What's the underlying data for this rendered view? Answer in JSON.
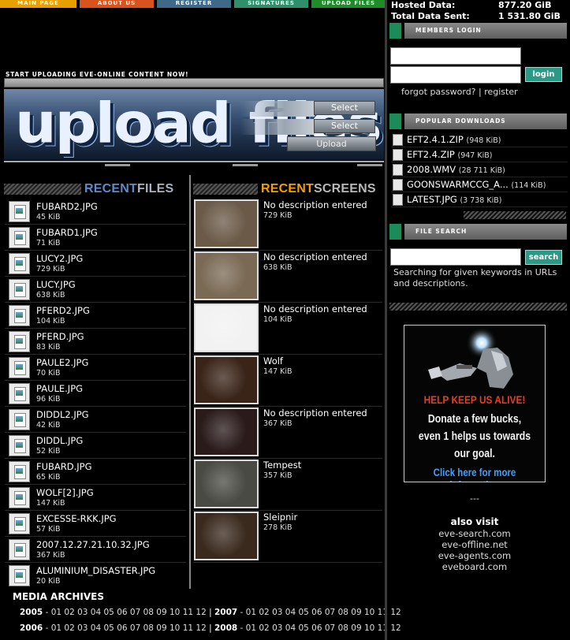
{
  "nav": {
    "tabs": [
      "MAIN PAGE",
      "ABOUT US",
      "REGISTER",
      "SIGNATURES",
      "UPLOAD FILES"
    ]
  },
  "stats": {
    "hosted_label": "Hosted Data:",
    "hosted_value": "877.20 GiB",
    "sent_label": "Total Data Sent:",
    "sent_value": "1 531.80 GiB"
  },
  "upload": {
    "intro": "START UPLOADING EVE-ONLINE CONTENT NOW!",
    "banner_title": "upload files",
    "select_label": "Select",
    "upload_label": "Upload"
  },
  "recent_files": {
    "heading_a": "RECENT",
    "heading_b": "FILES",
    "items": [
      {
        "name": "FUBARD2.JPG",
        "size": "45 KiB"
      },
      {
        "name": "FUBARD1.JPG",
        "size": "71 KiB"
      },
      {
        "name": "LUCY2.JPG",
        "size": "729 KiB"
      },
      {
        "name": "LUCY.JPG",
        "size": "638 KiB"
      },
      {
        "name": "PFERD2.JPG",
        "size": "104 KiB"
      },
      {
        "name": "PFERD.JPG",
        "size": "83 KiB"
      },
      {
        "name": "PAULE2.JPG",
        "size": "70 KiB"
      },
      {
        "name": "PAULE.JPG",
        "size": "96 KiB"
      },
      {
        "name": "DIDDL2.JPG",
        "size": "42 KiB"
      },
      {
        "name": "DIDDL.JPG",
        "size": "52 KiB"
      },
      {
        "name": "FUBARD.JPG",
        "size": "65 KiB"
      },
      {
        "name": "WOLF[2].JPG",
        "size": "147 KiB"
      },
      {
        "name": "EXCESSE-RKK.JPG",
        "size": "57 KiB"
      },
      {
        "name": "2007.12.27.21.10.32.JPG",
        "size": "367 KiB"
      },
      {
        "name": "ALUMINIUM_DISASTER.JPG",
        "size": "20 KiB"
      }
    ]
  },
  "recent_screens": {
    "heading_a": "RECENT",
    "heading_b": "SCREENS",
    "items": [
      {
        "desc": "No description entered",
        "size": "729 KiB",
        "color": "#6b5a48"
      },
      {
        "desc": "No description entered",
        "size": "638 KiB",
        "color": "#7a6a55"
      },
      {
        "desc": "No description entered",
        "size": "104 KiB",
        "color": "#f2f2f2"
      },
      {
        "desc": "Wolf",
        "size": "147 KiB",
        "color": "#3a2418"
      },
      {
        "desc": "No description entered",
        "size": "367 KiB",
        "color": "#2a1a1a"
      },
      {
        "desc": "Tempest",
        "size": "357 KiB",
        "color": "#4a4a44"
      },
      {
        "desc": "Sleipnir",
        "size": "278 KiB",
        "color": "#3a2a1e"
      }
    ]
  },
  "media_archives": {
    "title": "MEDIA ARCHIVES",
    "rows": [
      {
        "y1": "2005",
        "m1": "- 01 02 03 04 05 06 07 08 09 10 11 12",
        "sep": " | ",
        "y2": "2007",
        "m2": "- 01 02 03 04 05 06 07 08 09 10 11 12"
      },
      {
        "y1": "2006",
        "m1": "- 01 02 03 04 05 06 07 08 09 10 11 12",
        "sep": " | ",
        "y2": "2008",
        "m2": "- 01 02 03 04 05 06 07 08 09 10 11 12"
      }
    ]
  },
  "login": {
    "title": "MEMBERS LOGIN",
    "button": "login",
    "forgot": "forgot password?",
    "divider": " | ",
    "register": "register"
  },
  "popular": {
    "title": "POPULAR DOWNLOADS",
    "items": [
      {
        "name": "EFT2.4.1.ZIP",
        "size": "(948 KiB)"
      },
      {
        "name": "EFT2.4.ZIP",
        "size": "(947 KiB)"
      },
      {
        "name": "2008.WMV",
        "size": "(28 711 KiB)"
      },
      {
        "name": "GOONSWARMCCG_A...",
        "size": "(114 KiB)"
      },
      {
        "name": "LATEST.JPG",
        "size": "(3 738 KiB)"
      }
    ]
  },
  "file_search": {
    "title": "FILE SEARCH",
    "button": "search",
    "description": "Searching for given keywords in URLs and descriptions."
  },
  "donate": {
    "header": "HELP KEEP US ALIVE!",
    "line1": "Donate a few bucks,",
    "line2": "even 1 helps us towards",
    "line3": "our goal.",
    "cta": "Click here for more information"
  },
  "footer": {
    "dash": "---",
    "also_visit": "also visit",
    "links": [
      "eve-search.com",
      "eve-offline.net",
      "eve-agents.com",
      "eveboard.com"
    ]
  },
  "colors": {
    "accent_green": "#1d8a5a",
    "button_teal": "#2a9a87",
    "recent_blue": "#5d8bc9",
    "recent_orange": "#f2a100"
  }
}
